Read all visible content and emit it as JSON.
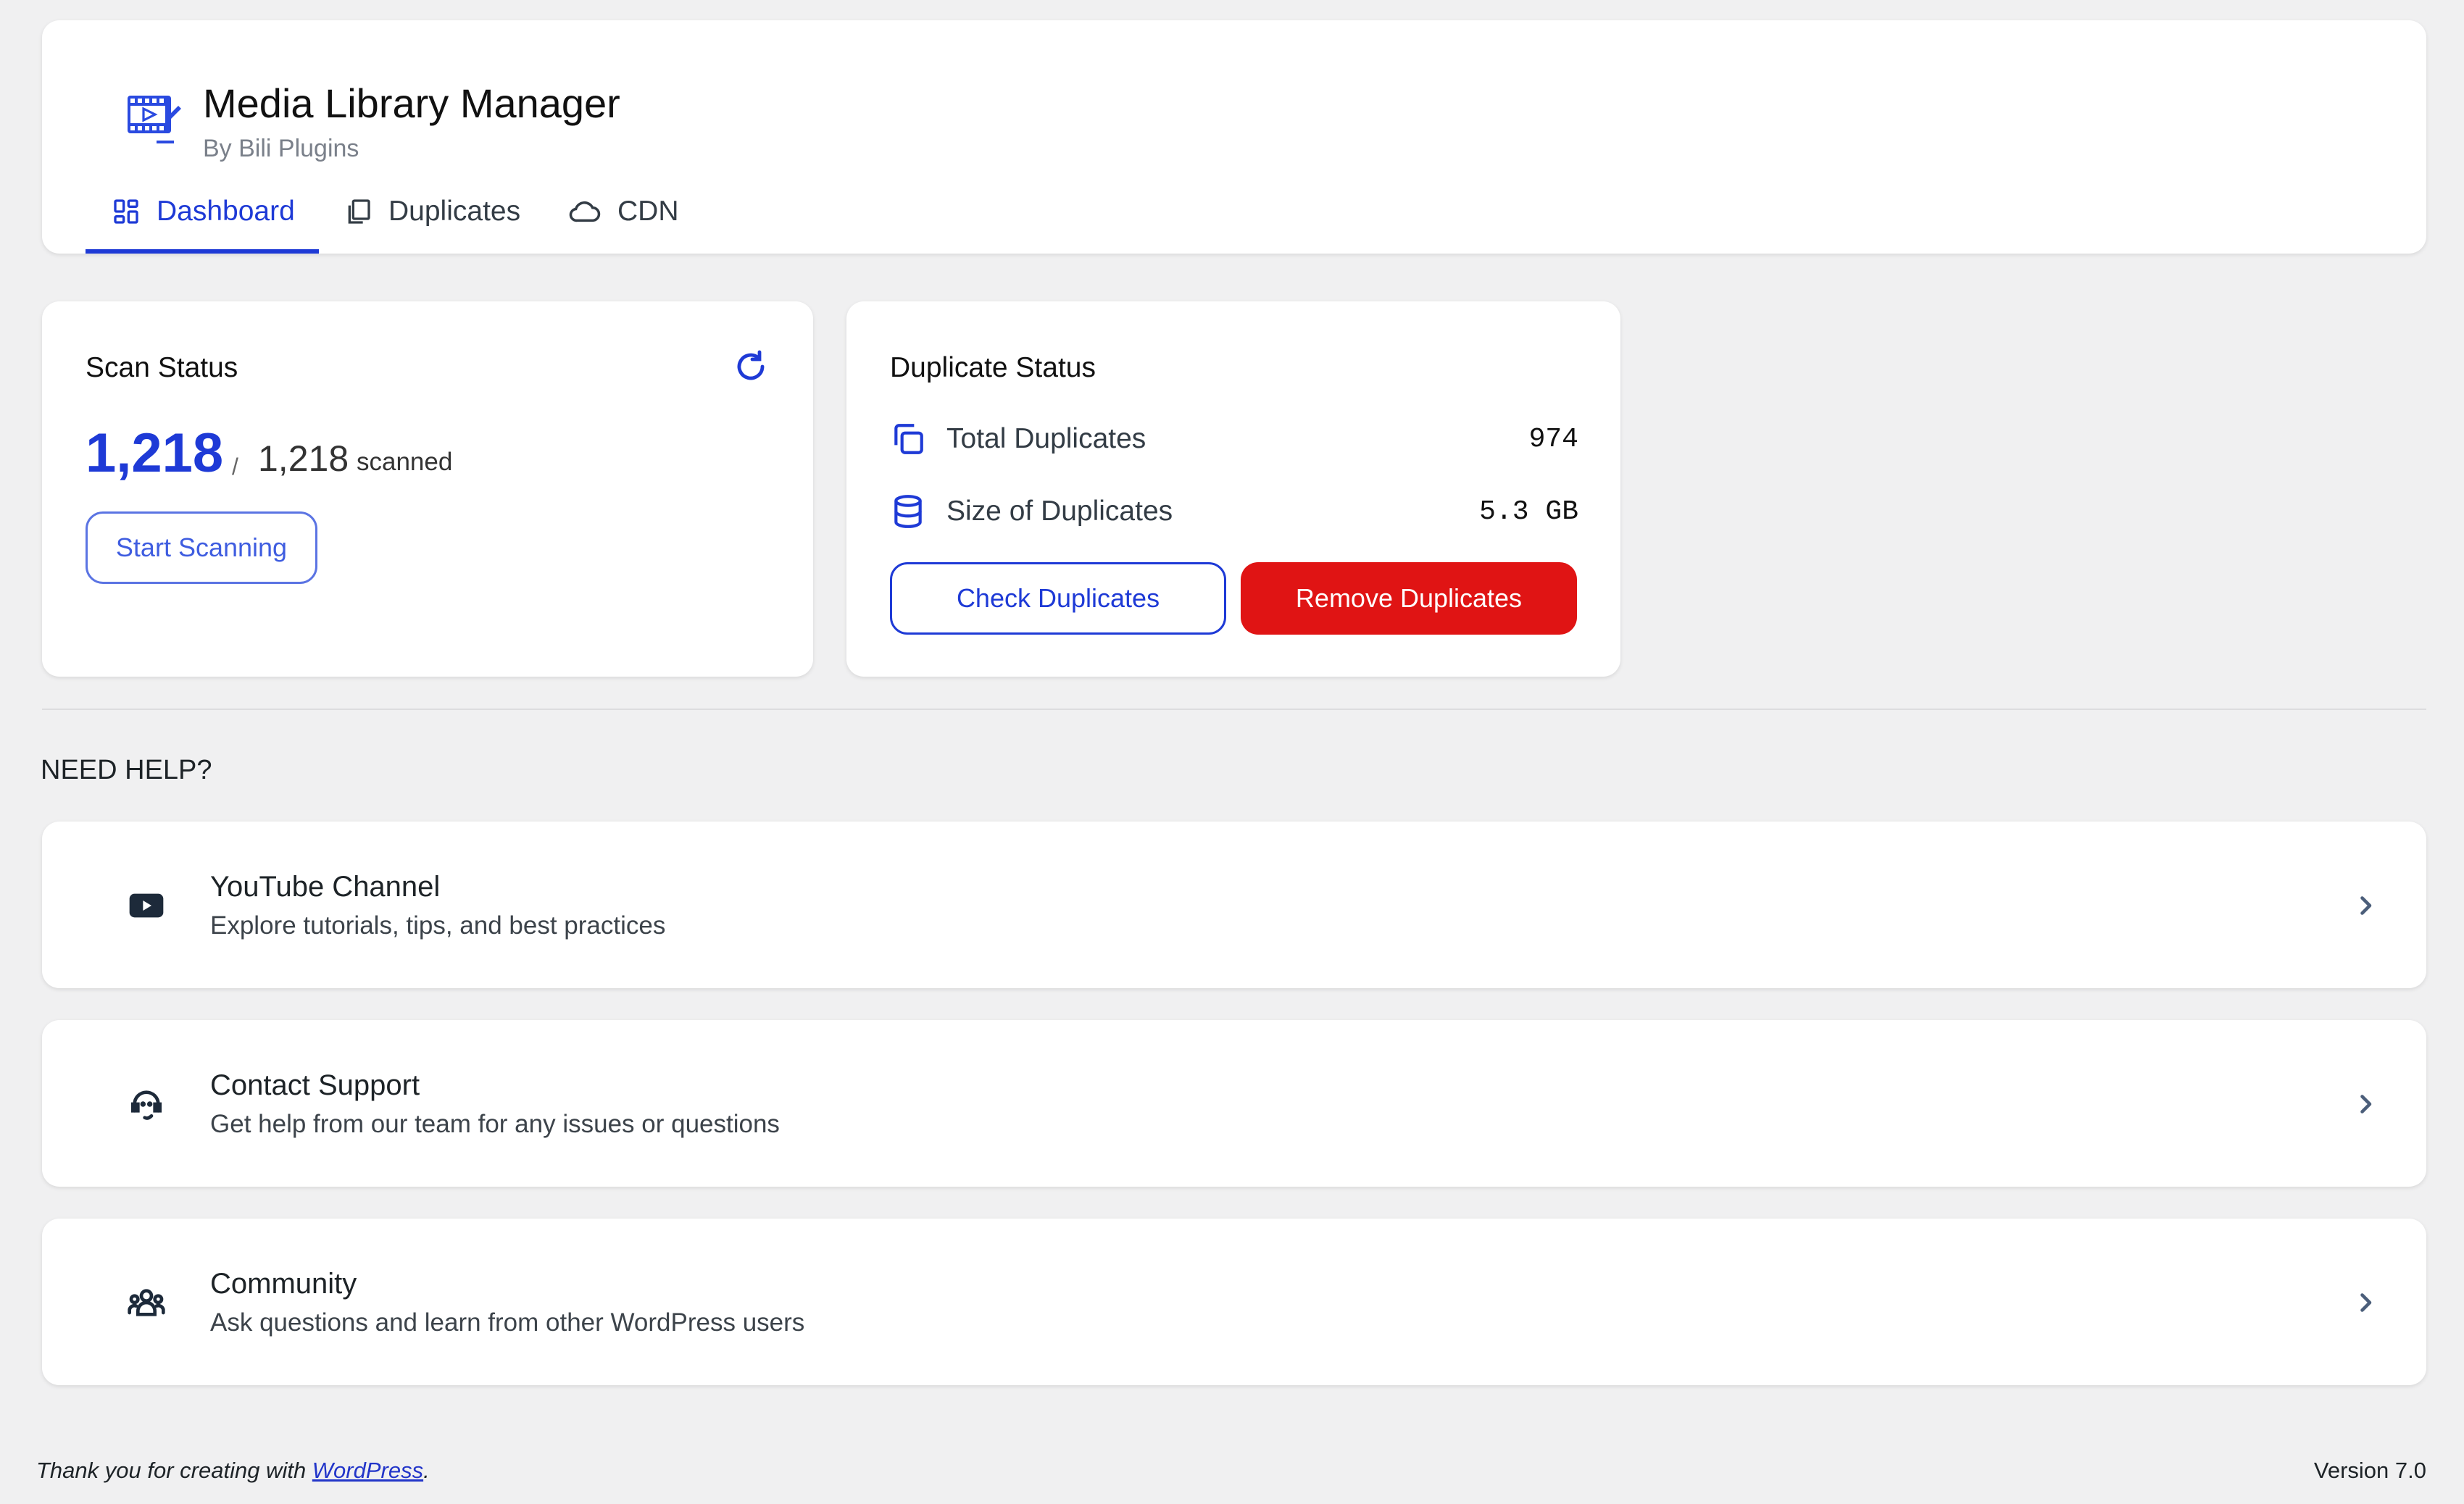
{
  "header": {
    "title": "Media Library Manager",
    "subtitle": "By Bili Plugins",
    "logo_icon": "media-film-edit-icon"
  },
  "tabs": [
    {
      "label": "Dashboard",
      "icon": "dashboard-grid-icon",
      "active": true
    },
    {
      "label": "Duplicates",
      "icon": "copy-icon",
      "active": false
    },
    {
      "label": "CDN",
      "icon": "cloud-icon",
      "active": false
    }
  ],
  "scan_status": {
    "title": "Scan Status",
    "scanned_count": "1,218",
    "separator": "/",
    "total_count": "1,218",
    "scanned_label": "scanned",
    "button_label": "Start Scanning",
    "refresh_icon": "refresh-icon"
  },
  "duplicate_status": {
    "title": "Duplicate Status",
    "rows": [
      {
        "label": "Total Duplicates",
        "value": "974",
        "icon": "copy-icon"
      },
      {
        "label": "Size of Duplicates",
        "value": "5.3 GB",
        "icon": "database-icon"
      }
    ],
    "check_button": "Check Duplicates",
    "remove_button": "Remove Duplicates"
  },
  "help": {
    "heading": "NEED HELP?",
    "items": [
      {
        "title": "YouTube Channel",
        "description": "Explore tutorials, tips, and best practices",
        "icon": "youtube-icon"
      },
      {
        "title": "Contact Support",
        "description": "Get help from our team for any issues or questions",
        "icon": "headset-icon"
      },
      {
        "title": "Community",
        "description": "Ask questions and learn from other WordPress users",
        "icon": "users-group-icon"
      }
    ]
  },
  "footer": {
    "text_before": "Thank you for creating with ",
    "link_text": "WordPress",
    "text_after": ".",
    "version": "Version 7.0"
  },
  "colors": {
    "accent": "#1e3ad6",
    "danger": "#e01414",
    "background": "#f0f0f1"
  }
}
